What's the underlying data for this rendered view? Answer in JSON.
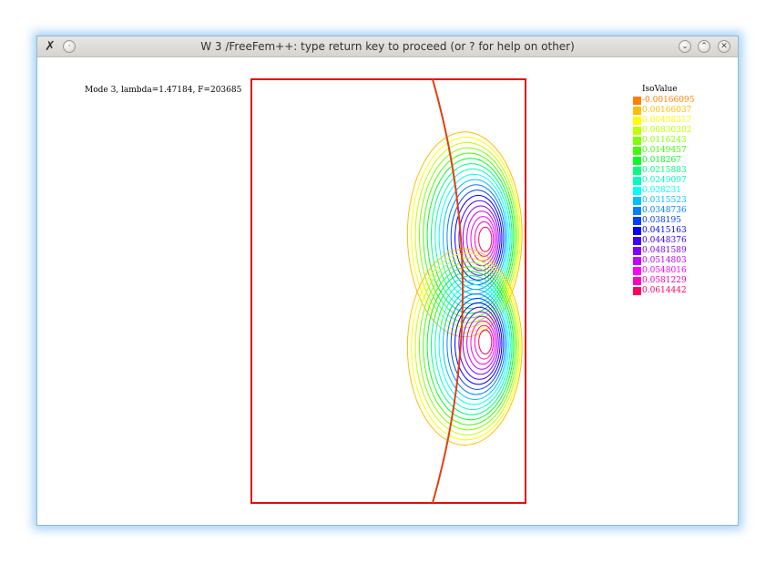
{
  "window": {
    "title": "W 3 /FreeFem++: type return key to proceed (or ? for help on other)",
    "app_icon": "freefem-app-icon",
    "menu_glyph": "·",
    "min_glyph": "⌄",
    "max_glyph": "⌃",
    "close_glyph": "✕"
  },
  "plot": {
    "info_text": "Mode 3, lambda=1.47184, F=203685",
    "legend_title": "IsoValue",
    "boundary_color": "#e01010",
    "interface_color": "#e04010"
  },
  "legend": [
    {
      "label": "-0.00166095",
      "color": "#ff8000"
    },
    {
      "label": "0.00166037",
      "color": "#ffbf00"
    },
    {
      "label": "0.00498317",
      "color": "#ffff00"
    },
    {
      "label": "0.00830302",
      "color": "#bfff00"
    },
    {
      "label": "0.0116243",
      "color": "#80ff00"
    },
    {
      "label": "0.0149457",
      "color": "#40ff00"
    },
    {
      "label": "0.018267",
      "color": "#00ff20"
    },
    {
      "label": "0.0215883",
      "color": "#00ff80"
    },
    {
      "label": "0.0249097",
      "color": "#00ffbf"
    },
    {
      "label": "0.028231",
      "color": "#00ffff"
    },
    {
      "label": "0.0315523",
      "color": "#00bfff"
    },
    {
      "label": "0.0348736",
      "color": "#0080ff"
    },
    {
      "label": "0.038195",
      "color": "#0040ff"
    },
    {
      "label": "0.0415163",
      "color": "#0000ff"
    },
    {
      "label": "0.0448376",
      "color": "#4000ff"
    },
    {
      "label": "0.0481589",
      "color": "#8000ff"
    },
    {
      "label": "0.0514803",
      "color": "#bf00ff"
    },
    {
      "label": "0.0548016",
      "color": "#ff00ff"
    },
    {
      "label": "0.0581229",
      "color": "#ff00bf"
    },
    {
      "label": "0.0614442",
      "color": "#ff0060"
    }
  ]
}
